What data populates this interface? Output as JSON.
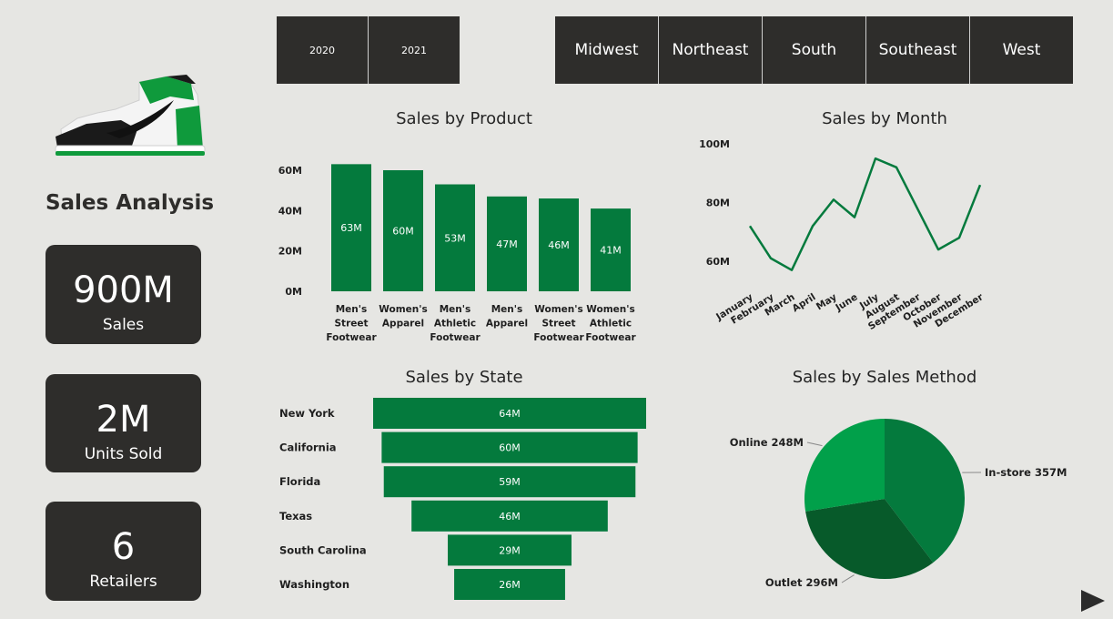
{
  "sidebar": {
    "title": "Sales Analysis",
    "kpis": [
      {
        "value": "900M",
        "label": "Sales"
      },
      {
        "value": "2M",
        "label": "Units Sold"
      },
      {
        "value": "6",
        "label": "Retailers"
      }
    ]
  },
  "filters": {
    "years": [
      "2020",
      "2021"
    ],
    "regions": [
      "Midwest",
      "Northeast",
      "South",
      "Southeast",
      "West"
    ]
  },
  "colors": {
    "green": "#047a3d",
    "green_light": "#01a04a",
    "green_dark": "#075a2a",
    "tile": "#2e2d2b",
    "background": "#e6e6e3"
  },
  "chart_data": [
    {
      "type": "bar",
      "title": "Sales by Product",
      "categories": [
        "Men's Street Footwear",
        "Women's Apparel",
        "Men's Athletic Footwear",
        "Men's Apparel",
        "Women's Street Footwear",
        "Women's Athletic Footwear"
      ],
      "category_lines": [
        [
          "Men's",
          "Street",
          "Footwear"
        ],
        [
          "Women's",
          "Apparel"
        ],
        [
          "Men's",
          "Athletic",
          "Footwear"
        ],
        [
          "Men's",
          "Apparel"
        ],
        [
          "Women's",
          "Street",
          "Footwear"
        ],
        [
          "Women's",
          "Athletic",
          "Footwear"
        ]
      ],
      "values": [
        63,
        60,
        53,
        47,
        46,
        41
      ],
      "data_labels": [
        "63M",
        "60M",
        "53M",
        "47M",
        "46M",
        "41M"
      ],
      "yticks": [
        "0M",
        "20M",
        "40M",
        "60M"
      ],
      "ylim": [
        0,
        60
      ],
      "grid": false
    },
    {
      "type": "line",
      "title": "Sales by Month",
      "categories": [
        "January",
        "February",
        "March",
        "April",
        "May",
        "June",
        "July",
        "August",
        "September",
        "October",
        "November",
        "December"
      ],
      "values": [
        72,
        61,
        57,
        72,
        81,
        75,
        95,
        92,
        78,
        64,
        68,
        86
      ],
      "yticks": [
        "60M",
        "80M",
        "100M"
      ],
      "ylim": [
        60,
        100
      ],
      "grid": false
    },
    {
      "type": "bar",
      "orientation": "horizontal-funnel",
      "title": "Sales by State",
      "categories": [
        "New York",
        "California",
        "Florida",
        "Texas",
        "South Carolina",
        "Washington"
      ],
      "values": [
        64,
        60,
        59,
        46,
        29,
        26
      ],
      "data_labels": [
        "64M",
        "60M",
        "59M",
        "46M",
        "29M",
        "26M"
      ]
    },
    {
      "type": "pie",
      "title": "Sales by Sales Method",
      "categories": [
        "In-store",
        "Outlet",
        "Online"
      ],
      "values": [
        357,
        296,
        248
      ],
      "data_labels": [
        "In-store 357M",
        "Outlet 296M",
        "Online 248M"
      ]
    }
  ]
}
